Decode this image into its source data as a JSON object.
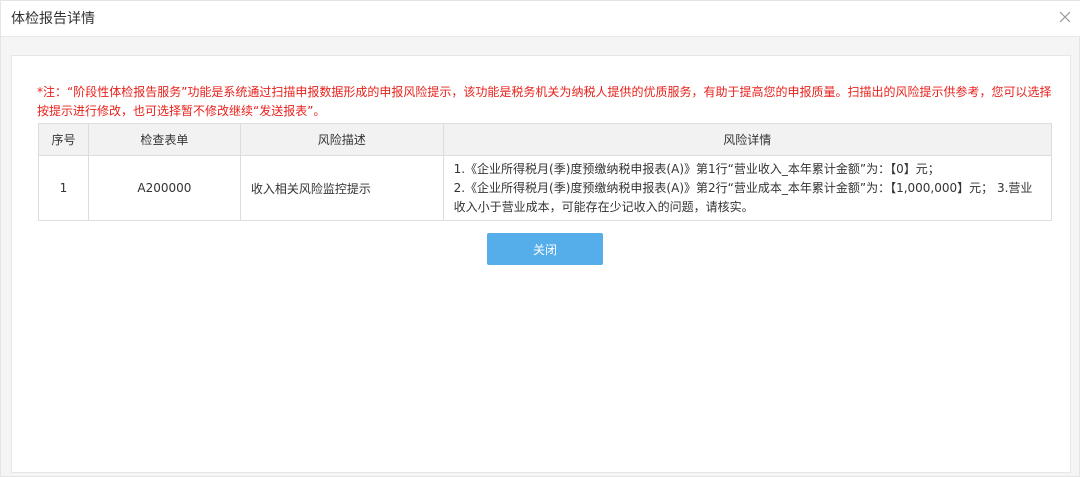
{
  "dialog": {
    "title": "体检报告详情",
    "close_icon": "close-icon"
  },
  "notice": "*注：“阶段性体检报告服务”功能是系统通过扫描申报数据形成的申报风险提示，该功能是税务机关为纳税人提供的优质服务，有助于提高您的申报质量。扫描出的风险提示供参考，您可以选择按提示进行修改，也可选择暂不修改继续“发送报表”。",
  "table": {
    "headers": [
      "序号",
      "检查表单",
      "风险描述",
      "风险详情"
    ],
    "rows": [
      {
        "index": "1",
        "form": "A200000",
        "description": "收入相关风险监控提示",
        "details": [
          "1.《企业所得税月(季)度预缴纳税申报表(A)》第1行“营业收入_本年累计金额”为：【0】元；",
          "2.《企业所得税月(季)度预缴纳税申报表(A)》第2行“营业成本_本年累计金额”为：【1,000,000】元； 3.营业收入小于营业成本，可能存在少记收入的问题，请核实。"
        ]
      }
    ]
  },
  "buttons": {
    "close_label": "关闭"
  },
  "colors": {
    "notice": "#e8211c",
    "button": "#55aeea",
    "header_bg": "#f2f2f2"
  }
}
